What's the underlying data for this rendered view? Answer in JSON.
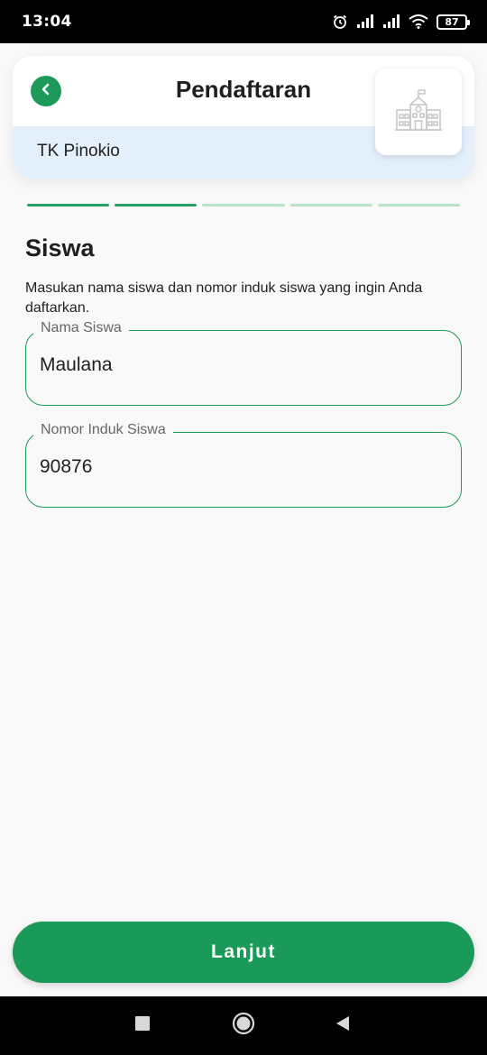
{
  "status_bar": {
    "time": "13:04",
    "battery": "87",
    "icons": [
      "alarm-icon",
      "signal-icon",
      "signal-icon",
      "wifi-icon",
      "battery-icon"
    ]
  },
  "header": {
    "back_icon": "chevron-left-icon",
    "title": "Pendaftaran",
    "school_name": "TK Pinokio",
    "logo_icon": "school-building-icon"
  },
  "progress": {
    "total_steps": 5,
    "completed_steps": 2
  },
  "section": {
    "title": "Siswa",
    "description": "Masukan nama siswa dan nomor induk siswa yang ingin Anda daftarkan."
  },
  "form": {
    "student_name": {
      "label": "Nama Siswa",
      "value": "Maulana"
    },
    "student_number": {
      "label": "Nomor Induk Siswa",
      "value": "90876"
    }
  },
  "actions": {
    "continue_label": "Lanjut"
  },
  "navigation": {
    "buttons": [
      "recents-icon",
      "home-icon",
      "back-icon"
    ]
  },
  "colors": {
    "accent": "#1d9a59",
    "step_inactive": "#b9e2cb",
    "header_band": "#e3f0fb",
    "background": "#f9f9f9"
  }
}
